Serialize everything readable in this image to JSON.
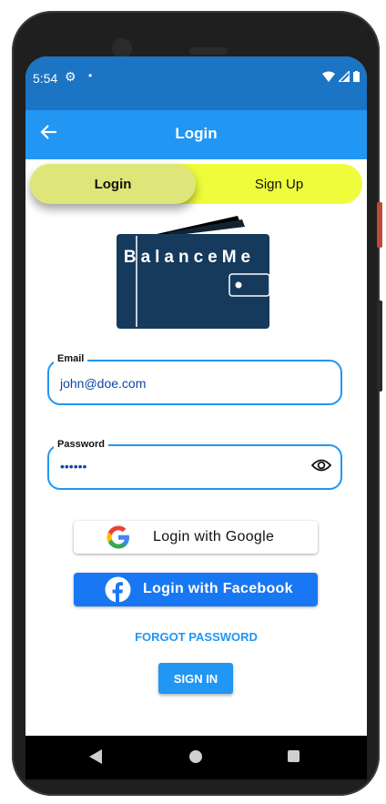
{
  "status": {
    "time": "5:54",
    "gear_icon": "gear-icon",
    "dot": "•"
  },
  "appbar": {
    "title": "Login",
    "back_icon": "arrow-left-icon"
  },
  "tabs": {
    "login": "Login",
    "signup": "Sign Up"
  },
  "logo": {
    "text": "BalanceMe"
  },
  "email": {
    "label": "Email",
    "value": "john@doe.com"
  },
  "password": {
    "label": "Password",
    "value": "••••••",
    "toggle_icon": "eye-icon"
  },
  "buttons": {
    "google": "Login with Google",
    "facebook": "Login with Facebook",
    "forgot": "FORGOT PASSWORD",
    "signin": "SIGN IN"
  },
  "colors": {
    "primary": "#2196f3",
    "statusbar": "#1b74c4",
    "tab_track": "#eefc3b",
    "tab_selected": "#dfe679",
    "facebook": "#1877f2",
    "wallet": "#133553"
  }
}
